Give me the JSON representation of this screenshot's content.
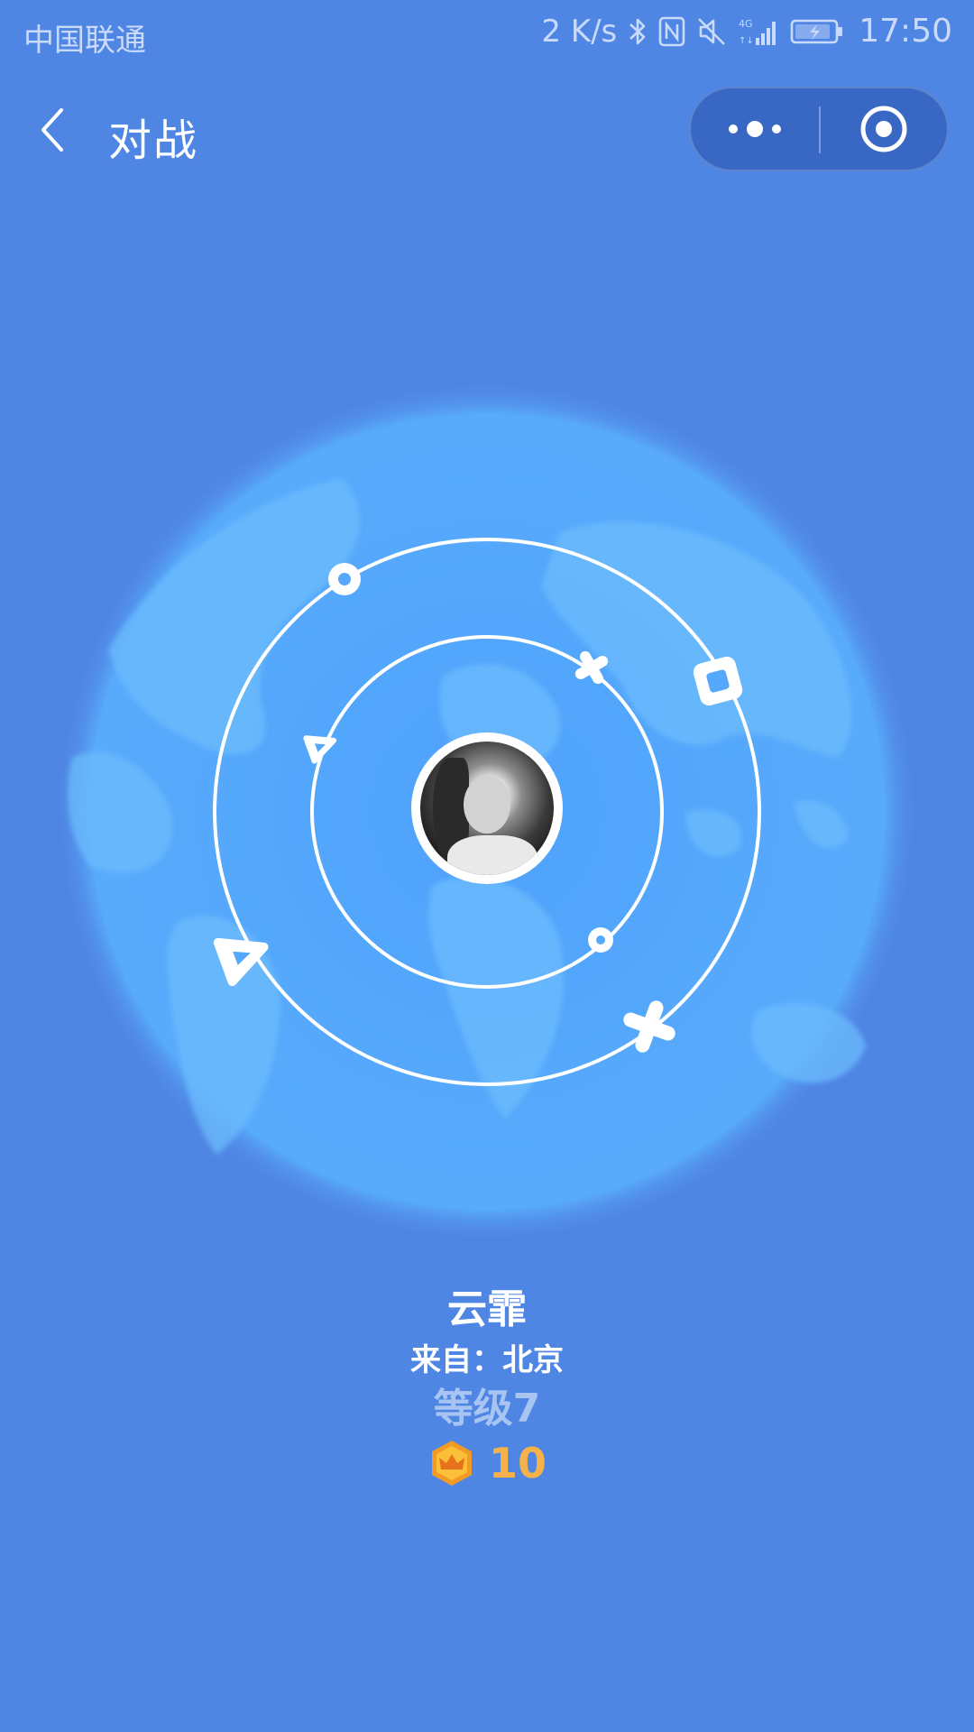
{
  "status_bar": {
    "carrier": "中国联通",
    "net_speed": "2 K/s",
    "time": "17:50",
    "icons": [
      "bluetooth-icon",
      "nfc-icon",
      "mute-icon",
      "4g-signal-icon",
      "battery-icon"
    ]
  },
  "nav": {
    "title": "对战",
    "back_icon": "chevron-left-icon",
    "more_icon": "more-dots-icon",
    "close_icon": "target-circle-icon"
  },
  "player": {
    "name": "云霏",
    "location": "来自：北京",
    "level": "等级7",
    "coins": "10",
    "coin_icon": "crown-coin-icon"
  },
  "colors": {
    "background": "#4f86e4",
    "globe": "#55a8fb",
    "orbit": "#ffffff",
    "level_text": "#a7c4f3",
    "coin_text": "#f6b24a"
  }
}
